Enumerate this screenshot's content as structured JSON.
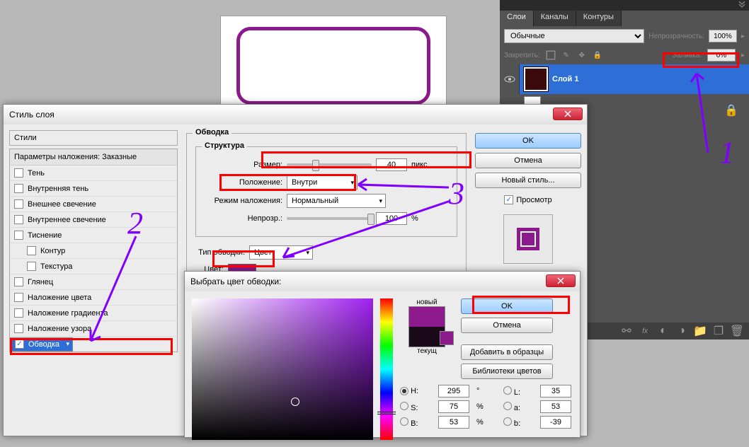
{
  "layers_panel": {
    "tabs": [
      "Слои",
      "Каналы",
      "Контуры"
    ],
    "mode": "Обычные",
    "opacity_label": "Непрозрачность:",
    "opacity_value": "100%",
    "lock_label": "Закрепить:",
    "fill_label": "Заливка:",
    "fill_value": "0%",
    "layer1_name": "Слой 1"
  },
  "layerstyle": {
    "title": "Стиль слоя",
    "styles_label": "Стили",
    "blend_header": "Параметры наложения: Заказные",
    "items": {
      "shadow": "Тень",
      "inner_shadow": "Внутренняя тень",
      "outer_glow": "Внешнее свечение",
      "inner_glow": "Внутреннее свечение",
      "bevel": "Тиснение",
      "contour": "Контур",
      "texture": "Текстура",
      "satin": "Глянец",
      "color_overlay": "Наложение цвета",
      "grad_overlay": "Наложение градиента",
      "pattern_overlay": "Наложение узора",
      "stroke": "Обводка"
    },
    "stroke_title": "Обводка",
    "structure_title": "Структура",
    "size_label": "Размер:",
    "size_value": "40",
    "size_unit": "пикс.",
    "position_label": "Положение:",
    "position_value": "Внутри",
    "blendmode_label": "Режим наложения:",
    "blendmode_value": "Нормальный",
    "opacity_label": "Непрозр.:",
    "opacity_value": "100",
    "opacity_unit": "%",
    "filltype_label": "Тип обводки:",
    "filltype_value": "Цвет",
    "color_label": "Цвет:",
    "ok": "OK",
    "cancel": "Отмена",
    "newstyle": "Новый стиль...",
    "preview": "Просмотр"
  },
  "colorpicker": {
    "title": "Выбрать цвет обводки:",
    "new_label": "новый",
    "current_label": "текущ",
    "ok": "OK",
    "cancel": "Отмена",
    "add_swatch": "Добавить в образцы",
    "color_libs": "Библиотеки цветов",
    "H_label": "H:",
    "H_val": "295",
    "H_unit": "°",
    "S_label": "S:",
    "S_val": "75",
    "S_unit": "%",
    "B_label": "B:",
    "B_val": "53",
    "B_unit": "%",
    "L_label": "L:",
    "L_val": "35",
    "a_label": "a:",
    "a_val": "53",
    "b_label": "b:",
    "b_val": "-39"
  },
  "annotations": {
    "n1": "1",
    "n2": "2",
    "n3": "3"
  }
}
